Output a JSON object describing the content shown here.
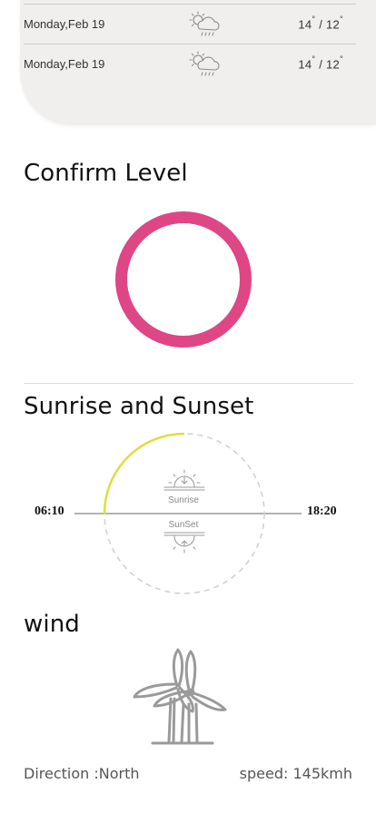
{
  "forecast": {
    "rows": [
      {
        "date": "Monday,Feb 19",
        "icon": "cloud-sun-rain-icon",
        "high": "14",
        "low": "12"
      },
      {
        "date": "Monday,Feb 19",
        "icon": "cloud-sun-rain-icon",
        "high": "14",
        "low": "12"
      }
    ]
  },
  "confirm": {
    "title": "Confirm Level",
    "ring_color": "#df4685"
  },
  "sun": {
    "title": "Sunrise and Sunset",
    "sunrise_time": "06:10",
    "sunset_time": "18:20",
    "sunrise_label": "Sunrise",
    "sunset_label": "SunSet",
    "arc_color": "#dede3c"
  },
  "wind": {
    "title": "wind",
    "icon": "wind-turbine-icon",
    "direction": "Direction :North",
    "speed": "speed: 145kmh"
  }
}
